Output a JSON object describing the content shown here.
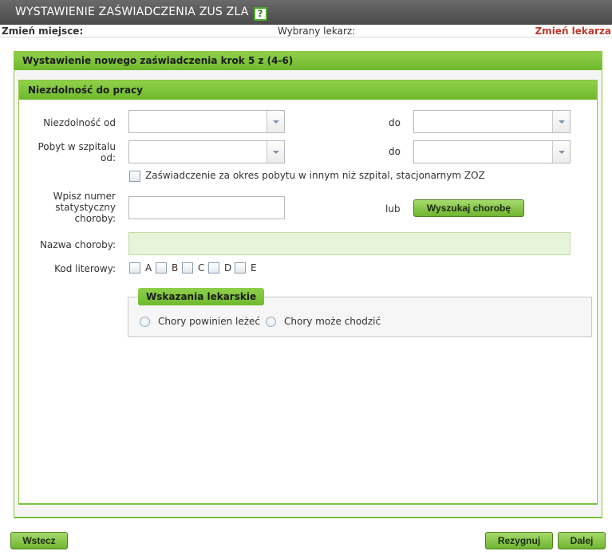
{
  "titlebar": {
    "title": "WYSTAWIENIE ZAŚWIADCZENIA ZUS ZLA",
    "help": "?"
  },
  "infobar": {
    "change_place": "Zmień miejsce:",
    "selected_doctor": "Wybrany lekarz:",
    "change_doctor": "Zmień lekarza"
  },
  "step": {
    "header": "Wystawienie nowego zaświadczenia krok 5 z (4-6)"
  },
  "section": {
    "header": "Niezdolność do pracy",
    "incapacity_from_label": "Niezdolność od",
    "incapacity_to_label": "do",
    "hospital_from_label": "Pobyt w szpitalu od:",
    "hospital_to_label": "do",
    "other_zoz_checkbox": "Zaświadczenie za okres pobytu w innym niż szpital, stacjonarnym ZOZ",
    "disease_number_label": "Wpisz numer statystyczny choroby:",
    "or_label": "lub",
    "search_disease_button": "Wyszukaj chorobę",
    "disease_name_label": "Nazwa choroby:",
    "letter_code_label": "Kod literowy:",
    "letter_codes": [
      "A",
      "B",
      "C",
      "D",
      "E"
    ],
    "indications_legend": "Wskazania lekarskie",
    "radio_must_lie": "Chory powinien leżeć",
    "radio_can_walk": "Chory może chodzić"
  },
  "footer": {
    "back_button": "Wstecz",
    "cancel_button": "Rezygnuj",
    "next_button": "Dalej"
  }
}
